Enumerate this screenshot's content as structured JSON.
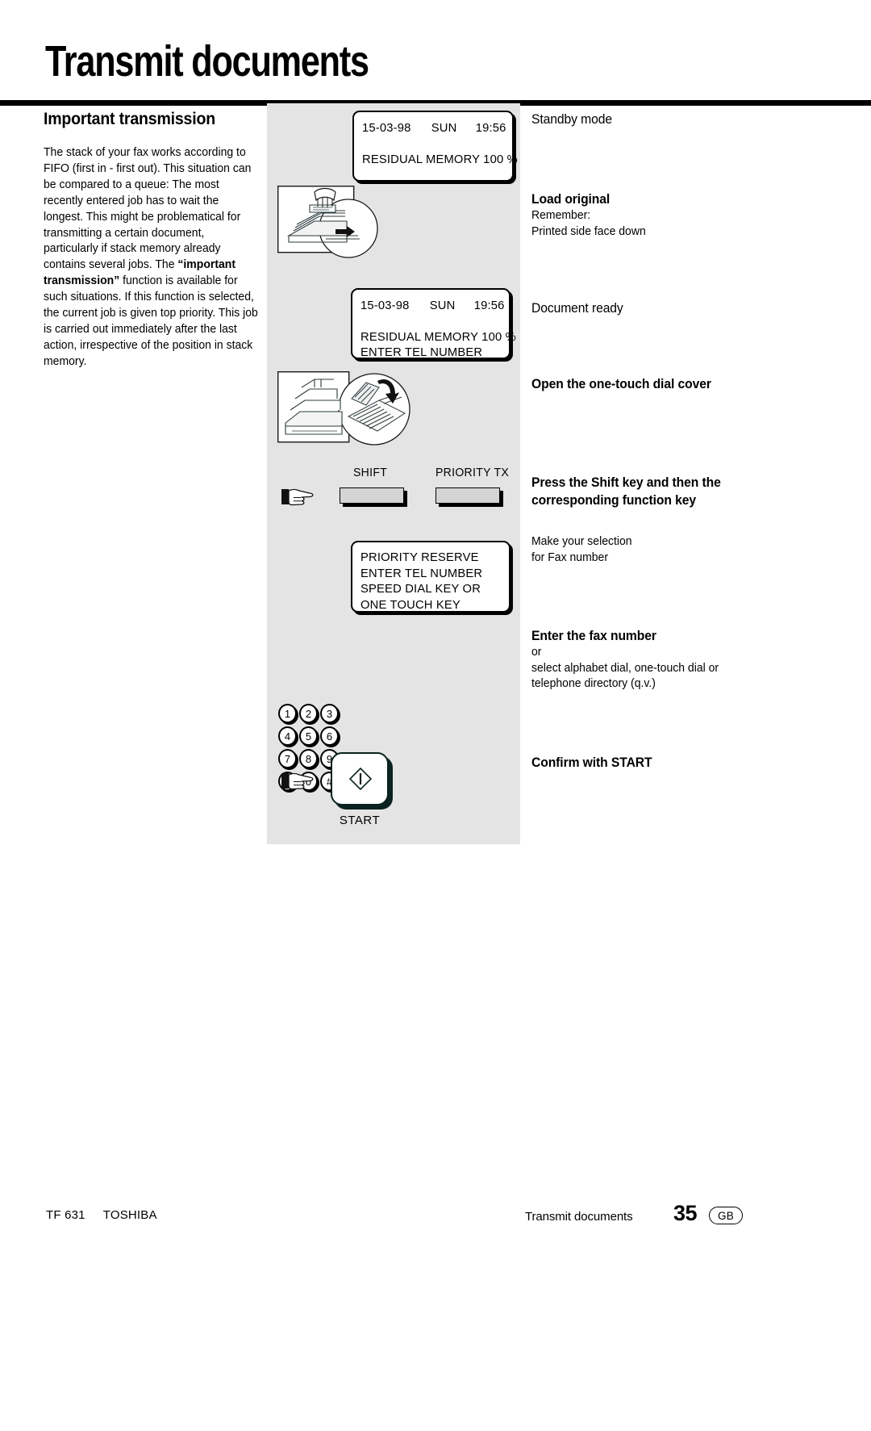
{
  "header": {
    "title": "Transmit documents"
  },
  "left": {
    "section_title": "Important  transmission",
    "paragraph_part1": "The stack of your fax works according to FIFO (first in - first out). This situation can be compared to a queue: The most recently entered job has to wait the longest. This might be problematical for transmitting a certain document, particularly if stack memory already contains several jobs. The ",
    "paragraph_bold": "“important transmission”",
    "paragraph_part2": " function is available for such situations. If this function is selected, the current job is given top priority. This job is carried out immediately after the last action, irrespective of the position in stack memory."
  },
  "lcd1": {
    "date": "15-03-98",
    "day": "SUN",
    "time": "19:56",
    "line2": "RESIDUAL MEMORY 100 %"
  },
  "lcd2": {
    "date": "15-03-98",
    "day": "SUN",
    "time": "19:56",
    "line2": "RESIDUAL MEMORY 100 %",
    "line3": "ENTER TEL NUMBER"
  },
  "lcd3": {
    "line1": "PRIORITY RESERVE",
    "line2": "ENTER TEL NUMBER",
    "line3": "SPEED DIAL KEY OR",
    "line4": "ONE TOUCH KEY"
  },
  "function_keys": {
    "shift_label": "SHIFT",
    "priority_label": "PRIORITY TX"
  },
  "keypad": {
    "rows": [
      [
        "1",
        "2",
        "3"
      ],
      [
        "4",
        "5",
        "6"
      ],
      [
        "7",
        "8",
        "9"
      ],
      [
        "✳",
        "0",
        "#"
      ]
    ]
  },
  "start": {
    "label": "START"
  },
  "instructions": [
    {
      "heading": "Standby mode",
      "bold": false,
      "lines": []
    },
    {
      "heading": "Load original",
      "bold": true,
      "lines": [
        "Remember:",
        "Printed side face down"
      ]
    },
    {
      "heading": "Document ready",
      "bold": false,
      "lines": []
    },
    {
      "heading": "Open the one-touch dial cover",
      "bold": true,
      "lines": []
    },
    {
      "heading": "Press the Shift key and then the corresponding function key",
      "bold": true,
      "lines": []
    },
    {
      "heading": "",
      "bold": false,
      "lines": [
        "Make your selection",
        "for Fax number"
      ]
    },
    {
      "heading": "Enter the fax number",
      "bold": true,
      "lines": [
        "or",
        "select alphabet dial, one-touch dial or",
        "telephone directory (q.v.)"
      ]
    },
    {
      "heading": "Confirm with START",
      "bold": true,
      "lines": []
    }
  ],
  "footer": {
    "model": "TF 631",
    "brand": "TOSHIBA",
    "chapter": "Transmit documents",
    "page_number": "35",
    "locale": "GB"
  },
  "colors": {
    "panel_gray": "#e4e4e4",
    "ink": "#000000",
    "key_gray": "#d4d4d4"
  }
}
